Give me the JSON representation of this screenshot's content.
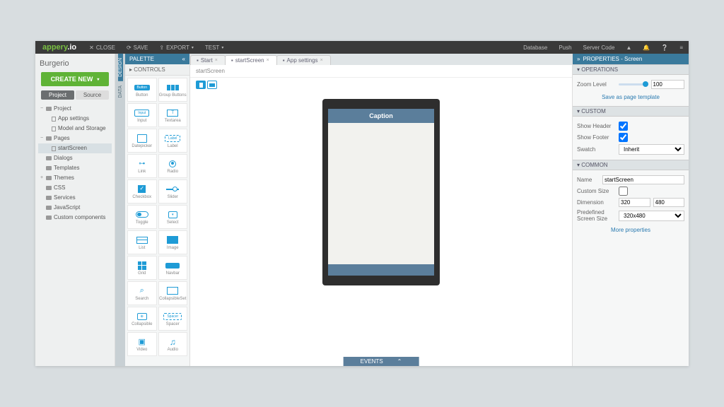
{
  "top": {
    "logo1": "appery",
    "logo2": ".io",
    "close": "CLOSE",
    "save": "SAVE",
    "export": "EXPORT",
    "test": "TEST",
    "database": "Database",
    "push": "Push",
    "server": "Server Code"
  },
  "left": {
    "title": "Burgerio",
    "create": "CREATE NEW",
    "tab_project": "Project",
    "tab_source": "Source",
    "tree": [
      {
        "t": "Project",
        "lvl": 0,
        "open": "−",
        "k": "folder"
      },
      {
        "t": "App settings",
        "lvl": 1,
        "k": "file"
      },
      {
        "t": "Model and Storage",
        "lvl": 1,
        "k": "file"
      },
      {
        "t": "Pages",
        "lvl": 0,
        "open": "−",
        "k": "folder"
      },
      {
        "t": "startScreen",
        "lvl": 1,
        "k": "file",
        "sel": true
      },
      {
        "t": "Dialogs",
        "lvl": 0,
        "open": "",
        "k": "folder"
      },
      {
        "t": "Templates",
        "lvl": 0,
        "open": "",
        "k": "folder"
      },
      {
        "t": "Themes",
        "lvl": 0,
        "open": "+",
        "k": "folder"
      },
      {
        "t": "CSS",
        "lvl": 0,
        "open": "",
        "k": "folder"
      },
      {
        "t": "Services",
        "lvl": 0,
        "open": "",
        "k": "folder"
      },
      {
        "t": "JavaScript",
        "lvl": 0,
        "open": "",
        "k": "folder"
      },
      {
        "t": "Custom components",
        "lvl": 0,
        "open": "",
        "k": "folder"
      }
    ]
  },
  "vtabs": {
    "design": "DESIGN",
    "data": "DATA"
  },
  "palette": {
    "title": "PALETTE",
    "sub": "CONTROLS",
    "items": [
      [
        "Button",
        "Group Buttons"
      ],
      [
        "Input",
        "Textarea"
      ],
      [
        "Datepicker",
        "Label"
      ],
      [
        "Link",
        "Radio"
      ],
      [
        "Checkbox",
        "Slider"
      ],
      [
        "Toggle",
        "Select"
      ],
      [
        "List",
        "Image"
      ],
      [
        "Grid",
        "Navbar"
      ],
      [
        "Search",
        "CollapsibleSet"
      ],
      [
        "Collapsible",
        "Spacer"
      ],
      [
        "Video",
        "Audio"
      ]
    ]
  },
  "tabs": [
    {
      "t": "Start"
    },
    {
      "t": "startScreen",
      "act": true
    },
    {
      "t": "App settings"
    }
  ],
  "crumb": "startScreen",
  "device": {
    "caption": "Caption"
  },
  "events": "EVENTS",
  "props": {
    "title": "PROPERTIES - Screen",
    "ops": "OPERATIONS",
    "zoom_lbl": "Zoom Level",
    "zoom_val": "100",
    "save_tpl": "Save as page template",
    "custom": "CUSTOM",
    "show_header": "Show Header",
    "show_footer": "Show Footer",
    "swatch_lbl": "Swatch",
    "swatch_val": "Inherit",
    "common": "COMMON",
    "name_lbl": "Name",
    "name_val": "startScreen",
    "custom_size": "Custom Size",
    "dim_lbl": "Dimension",
    "dim_w": "320",
    "dim_h": "480",
    "pss_lbl": "Predefined Screen Size",
    "pss_val": "320x480",
    "more": "More properties"
  }
}
